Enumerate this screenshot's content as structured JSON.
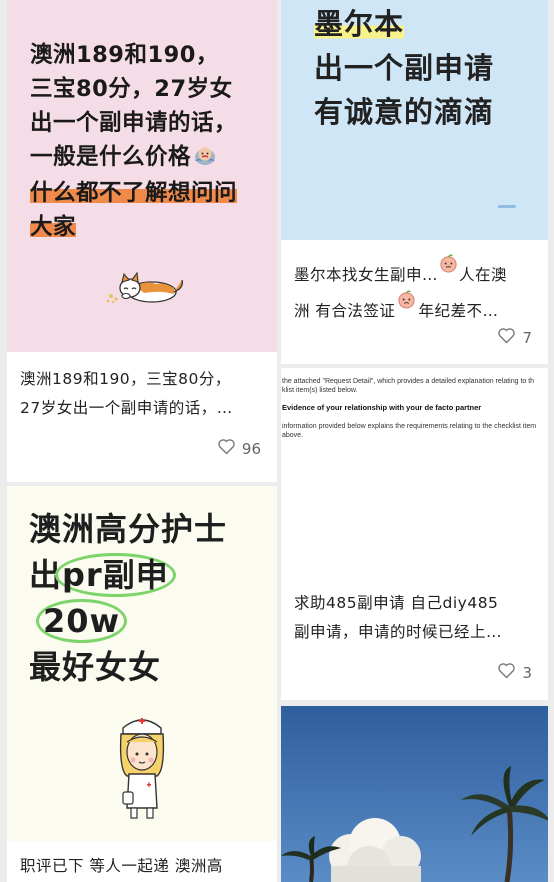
{
  "feed": {
    "cards": [
      {
        "cover_lines": [
          "澳洲189和190，",
          "三宝80分，27岁女",
          "出一个副申请的话，",
          "一般是什么价格",
          "什么都不了解想问问",
          "大家"
        ],
        "title_lines": [
          "澳洲189和190，三宝80分，",
          "27岁女出一个副申请的话，…"
        ],
        "likes": "96",
        "icons": [
          "crying-face-icon",
          "cat-icon",
          "heart-icon"
        ]
      },
      {
        "cover_lines": [
          "墨尔本",
          "出一个副申请",
          "有诚意的滴滴"
        ],
        "title_lines": [
          "墨尔本找女生副申…",
          "人在澳",
          "洲 有合法签证",
          "年纪差不…"
        ],
        "likes": "7",
        "icons": [
          "peach-face-icon",
          "heart-icon"
        ]
      },
      {
        "doc_lines": [
          "the attached \"Request Detail\", which provides a detailed explanation relating to th",
          "klist item(s) listed below.",
          "Evidence of your relationship with your de facto partner",
          "information provided below explains the requirements relating to the checklist item",
          "above."
        ],
        "title_lines": [
          "求助485副申请 自己diy485",
          "副申请，申请的时候已经上…"
        ],
        "likes": "3",
        "icons": [
          "heart-icon"
        ]
      },
      {
        "cover_lines": [
          "澳洲高分护士",
          "出",
          "pr副申",
          "20w",
          "最好女女"
        ],
        "title_lines": [
          "职评已下 等人一起递 澳洲高"
        ],
        "icons": [
          "nurse-icon"
        ]
      },
      {
        "icons": [
          "palm-tree-icon",
          "cloud-icon"
        ]
      }
    ]
  },
  "colors": {
    "card1_bg": "#f5dde8",
    "card2_bg": "#cfe6f6",
    "highlight_orange": "#f08a4b",
    "highlight_yellow": "#f7f38a",
    "circle_green": "#7dd46a"
  }
}
